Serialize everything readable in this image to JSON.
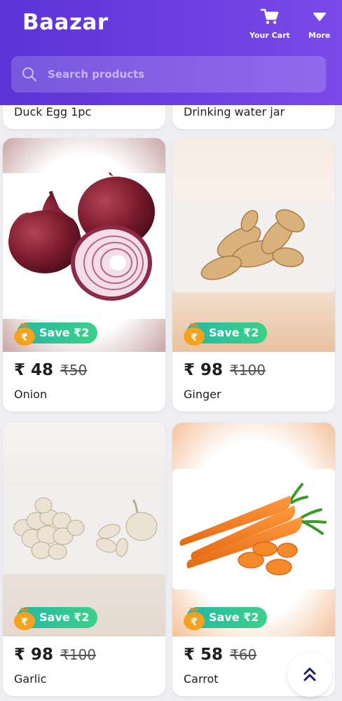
{
  "app": {
    "brand": "Baazar"
  },
  "header": {
    "cart": {
      "label": "Your Cart",
      "icon": "cart-icon"
    },
    "more": {
      "label": "More",
      "icon": "chevron-down-icon"
    }
  },
  "search": {
    "placeholder": "Search products",
    "icon": "search-icon"
  },
  "partial_items": [
    {
      "name": "Duck Egg 1pc"
    },
    {
      "name": "Drinking water jar"
    }
  ],
  "products": [
    {
      "name": "Onion",
      "price": "₹ 48",
      "mrp": "₹50",
      "save": "Save ₹2"
    },
    {
      "name": "Ginger",
      "price": "₹ 98",
      "mrp": "₹100",
      "save": "Save ₹2"
    },
    {
      "name": "Garlic",
      "price": "₹ 98",
      "mrp": "₹100",
      "save": "Save ₹2"
    },
    {
      "name": "Carrot",
      "price": "₹ 58",
      "mrp": "₹60",
      "save": "Save ₹2"
    }
  ],
  "colors": {
    "header": "#5b33d6",
    "save_badge": "#2ec79a",
    "coin": "#f5a21f"
  }
}
